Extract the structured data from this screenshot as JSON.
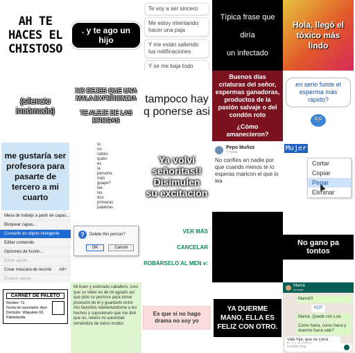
{
  "stickers": {
    "s1": {
      "lines": [
        "AH TE",
        "HACES EL",
        "CHISTOSO"
      ]
    },
    "s2": {
      "text": ". y te ago un hijo"
    },
    "s3": {
      "lines": [
        "Te voy a ser sincero",
        "Me estoy intentando hacer una paja",
        "Y me están saliendo tus notificaciones",
        "Y se me baja todo"
      ]
    },
    "s4": {
      "lines": [
        "Típica frase que",
        "diría",
        "un infectado"
      ]
    },
    "s5": {
      "text": "Hola, llegó el tóxico más lindo"
    },
    "s6": {
      "text": "(silencio incómodo)"
    },
    "s7": {
      "lines": [
        "NO DEJES QUE UNA MALA EXPERIENCIA",
        "TE ALEJE DE LAS DROGAS"
      ]
    },
    "s8": {
      "text": "tampoco hay q ponerse asi"
    },
    "s9": {
      "lines": [
        "Buenos días criaturas del señor, espermas ganadoras, productos de la pasión salvaje o del condón roto",
        "¿Cómo amanecieron?"
      ]
    },
    "s10": {
      "text": "en serio fuiste el esperma más rápido?"
    },
    "s11": {
      "text": "me gustaría ser profesora para pasarte de tercero a mi cuarto"
    },
    "s12": {
      "words": [
        "tu",
        "no",
        "sabes",
        "quién",
        "es",
        "la",
        "persona",
        "más",
        "guape?",
        "lee",
        "las",
        "dos",
        "primeras",
        "palabras"
      ]
    },
    "s13": {
      "lines": [
        "Ya volví",
        "señoritas!!",
        "Disimulen",
        "su excitación"
      ]
    },
    "s14": {
      "name": "Pepo Muñoz",
      "handle": "7 horas",
      "text": "No confíes en nadie por que cuando menos te lo esperas maricon el que lo lea"
    },
    "s15": {
      "selected": "Mujer",
      "items": [
        "Cortar",
        "Copiar",
        "Pegar",
        "Eliminar"
      ]
    },
    "s16": {
      "items": [
        "Mesa de trabajo a partir de capas...",
        "Bloquear capas...",
        "Convertir en objeto inteligente",
        "Editar contenido",
        "Opciones de fusión...",
        "Editar ajuste...",
        "Crear máscara de recorte",
        "Enlazar capas"
      ],
      "shortcut": "Alt+"
    },
    "s17": {
      "question": "Delete this person?",
      "ok": "OK",
      "cancel": "Cancel"
    },
    "s18": {
      "actions": [
        "VER MÁS",
        "CANCELAR",
        "ROBÁRSELO AL MEN v:"
      ]
    },
    "s19": {
      "text": "No gano pa tontos"
    },
    "s20": {
      "title": "CARNET DE PALETO",
      "lines": [
        "Nombre: Tú",
        "Fecha de nacimiento: Ayer",
        "Domicilio: Villapaleto 69, Paletolandia"
      ]
    },
    "s21": {
      "text": "Mi buen y estimado caballero, creo que su stiker es de mi agrado así que pido su permiso para tomar posesión de él y guardarlo entre mis favoritos Adelantandome a los hechos y suponiendo que me diré que no, retiero mi autoridad tomándolo de todos modos"
    },
    "s22": {
      "text": "Es que si no hago drama no soy yo"
    },
    "s23": {
      "text": "YA DUERME MANO, ELLA ES FELIZ CON OTRO."
    },
    "s24": {
      "contact": "Mamá",
      "status": "en línea",
      "messages": [
        "Mamá!!!",
        "HOY",
        "Mamá. Quedé con Luis",
        "Como fuera, como fuera y duermo fuera vale?",
        "Vale hija, que se corra fuera también"
      ],
      "input": "Escribir msg"
    }
  },
  "colors": {
    "maroon": "#7a1220",
    "whatsapp": "#075e54",
    "blue_box": "#cfe4f5",
    "select": "#1e5fbf"
  }
}
